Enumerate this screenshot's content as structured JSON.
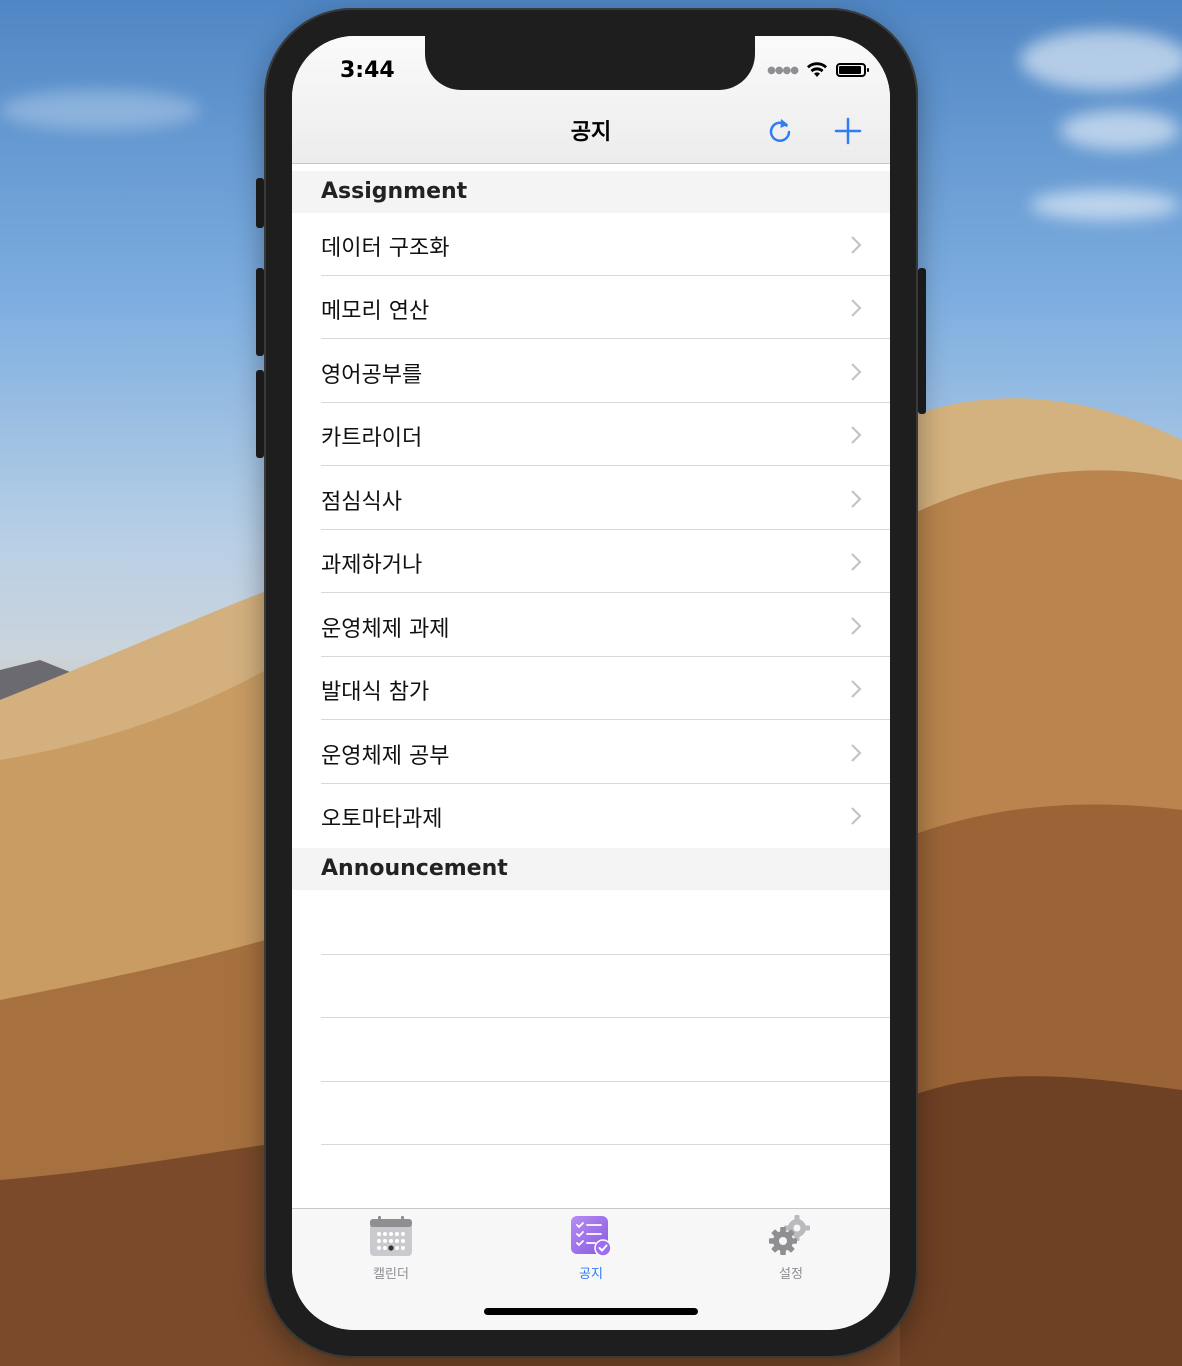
{
  "status_bar": {
    "time": "3:44"
  },
  "nav": {
    "title": "공지",
    "refresh_icon": "refresh-icon",
    "add_icon": "plus-icon",
    "accent_color": "#2f7cf6"
  },
  "sections": {
    "assignment": {
      "header": "Assignment",
      "items": [
        {
          "label": "데이터 구조화"
        },
        {
          "label": "메모리 연산"
        },
        {
          "label": "영어공부를"
        },
        {
          "label": "카트라이더"
        },
        {
          "label": "점심식사"
        },
        {
          "label": "과제하거나"
        },
        {
          "label": "운영체제 과제"
        },
        {
          "label": "발대식 참가"
        },
        {
          "label": "운영체제 공부"
        },
        {
          "label": "오토마타과제"
        }
      ]
    },
    "announcement": {
      "header": "Announcement",
      "items": []
    }
  },
  "tabbar": {
    "tabs": [
      {
        "label": "캘린더",
        "icon": "calendar-icon",
        "active": false
      },
      {
        "label": "공지",
        "icon": "checklist-icon",
        "active": true
      },
      {
        "label": "설정",
        "icon": "gear-icon",
        "active": false
      }
    ]
  }
}
